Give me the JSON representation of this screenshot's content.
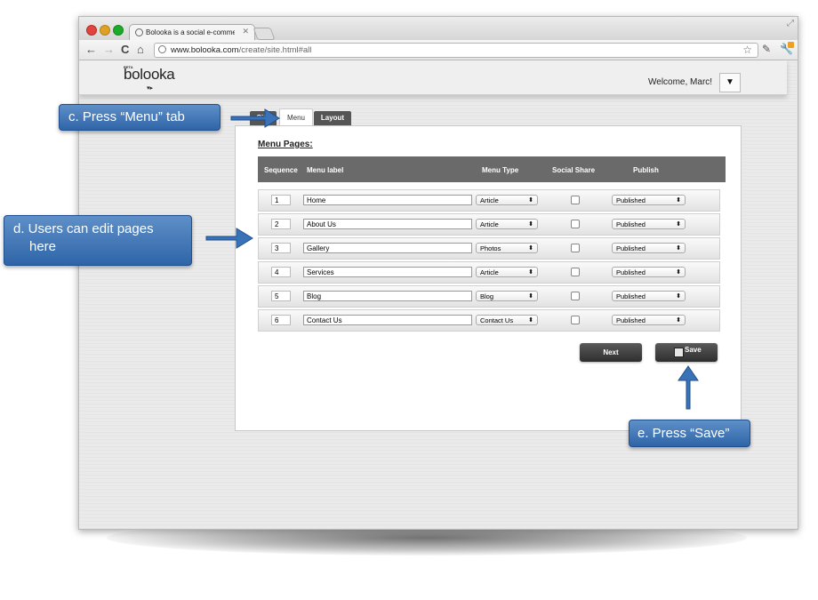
{
  "browser": {
    "tab_title": "Bolooka is a social e-comme",
    "tab_close": "✕",
    "back": "←",
    "forward": "→",
    "reload": "C",
    "home": "⌂",
    "url_host": "www.bolooka.com",
    "url_path": "/create/site.html#all",
    "star": "☆",
    "ext_icon": "✎",
    "wrench_icon": "🔧",
    "resize": "⤢"
  },
  "site": {
    "beta": "BETA",
    "logo": "bolooka",
    "logo_mark": "▾▸",
    "welcome": "Welcome, Marc!",
    "user_menu_arrow": "▼"
  },
  "editor": {
    "tabs": [
      {
        "label": "Site"
      },
      {
        "label": "Menu"
      },
      {
        "label": "Layout"
      }
    ],
    "section_title": "Menu Pages:",
    "columns": {
      "sequence": "Sequence",
      "label": "Menu label",
      "type": "Menu Type",
      "social": "Social Share",
      "publish": "Publish"
    },
    "rows": [
      {
        "seq": "1",
        "label": "Home",
        "type": "Article",
        "publish": "Published"
      },
      {
        "seq": "2",
        "label": "About Us",
        "type": "Article",
        "publish": "Published"
      },
      {
        "seq": "3",
        "label": "Gallery",
        "type": "Photos",
        "publish": "Published"
      },
      {
        "seq": "4",
        "label": "Services",
        "type": "Article",
        "publish": "Published"
      },
      {
        "seq": "5",
        "label": "Blog",
        "type": "Blog",
        "publish": "Published"
      },
      {
        "seq": "6",
        "label": "Contact Us",
        "type": "Contact Us",
        "publish": "Published"
      }
    ],
    "next_label": "Next",
    "save_label": "Save",
    "select_arrows": "⬍"
  },
  "callouts": {
    "c": "c. Press “Menu” tab",
    "d_line1": "d. Users can edit pages",
    "d_line2": "here",
    "e": "e. Press “Save”"
  },
  "colors": {
    "callout": "#3a72b8",
    "header_row": "#6a6a6a",
    "button_dark": "#3a3a3a",
    "traffic_red": "#e0443e",
    "traffic_yellow": "#dea123",
    "traffic_green": "#1aab29"
  }
}
